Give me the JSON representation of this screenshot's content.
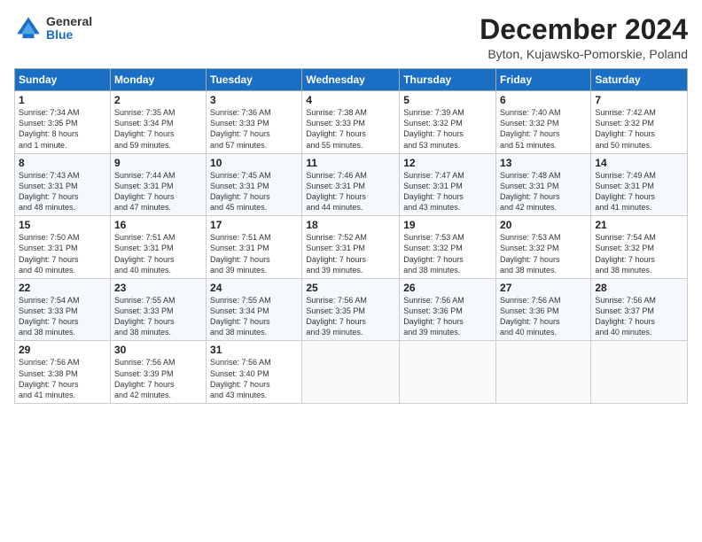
{
  "header": {
    "logo_general": "General",
    "logo_blue": "Blue",
    "month_title": "December 2024",
    "location": "Byton, Kujawsko-Pomorskie, Poland"
  },
  "weekdays": [
    "Sunday",
    "Monday",
    "Tuesday",
    "Wednesday",
    "Thursday",
    "Friday",
    "Saturday"
  ],
  "weeks": [
    [
      {
        "day": "1",
        "info": "Sunrise: 7:34 AM\nSunset: 3:35 PM\nDaylight: 8 hours\nand 1 minute."
      },
      {
        "day": "2",
        "info": "Sunrise: 7:35 AM\nSunset: 3:34 PM\nDaylight: 7 hours\nand 59 minutes."
      },
      {
        "day": "3",
        "info": "Sunrise: 7:36 AM\nSunset: 3:33 PM\nDaylight: 7 hours\nand 57 minutes."
      },
      {
        "day": "4",
        "info": "Sunrise: 7:38 AM\nSunset: 3:33 PM\nDaylight: 7 hours\nand 55 minutes."
      },
      {
        "day": "5",
        "info": "Sunrise: 7:39 AM\nSunset: 3:32 PM\nDaylight: 7 hours\nand 53 minutes."
      },
      {
        "day": "6",
        "info": "Sunrise: 7:40 AM\nSunset: 3:32 PM\nDaylight: 7 hours\nand 51 minutes."
      },
      {
        "day": "7",
        "info": "Sunrise: 7:42 AM\nSunset: 3:32 PM\nDaylight: 7 hours\nand 50 minutes."
      }
    ],
    [
      {
        "day": "8",
        "info": "Sunrise: 7:43 AM\nSunset: 3:31 PM\nDaylight: 7 hours\nand 48 minutes."
      },
      {
        "day": "9",
        "info": "Sunrise: 7:44 AM\nSunset: 3:31 PM\nDaylight: 7 hours\nand 47 minutes."
      },
      {
        "day": "10",
        "info": "Sunrise: 7:45 AM\nSunset: 3:31 PM\nDaylight: 7 hours\nand 45 minutes."
      },
      {
        "day": "11",
        "info": "Sunrise: 7:46 AM\nSunset: 3:31 PM\nDaylight: 7 hours\nand 44 minutes."
      },
      {
        "day": "12",
        "info": "Sunrise: 7:47 AM\nSunset: 3:31 PM\nDaylight: 7 hours\nand 43 minutes."
      },
      {
        "day": "13",
        "info": "Sunrise: 7:48 AM\nSunset: 3:31 PM\nDaylight: 7 hours\nand 42 minutes."
      },
      {
        "day": "14",
        "info": "Sunrise: 7:49 AM\nSunset: 3:31 PM\nDaylight: 7 hours\nand 41 minutes."
      }
    ],
    [
      {
        "day": "15",
        "info": "Sunrise: 7:50 AM\nSunset: 3:31 PM\nDaylight: 7 hours\nand 40 minutes."
      },
      {
        "day": "16",
        "info": "Sunrise: 7:51 AM\nSunset: 3:31 PM\nDaylight: 7 hours\nand 40 minutes."
      },
      {
        "day": "17",
        "info": "Sunrise: 7:51 AM\nSunset: 3:31 PM\nDaylight: 7 hours\nand 39 minutes."
      },
      {
        "day": "18",
        "info": "Sunrise: 7:52 AM\nSunset: 3:31 PM\nDaylight: 7 hours\nand 39 minutes."
      },
      {
        "day": "19",
        "info": "Sunrise: 7:53 AM\nSunset: 3:32 PM\nDaylight: 7 hours\nand 38 minutes."
      },
      {
        "day": "20",
        "info": "Sunrise: 7:53 AM\nSunset: 3:32 PM\nDaylight: 7 hours\nand 38 minutes."
      },
      {
        "day": "21",
        "info": "Sunrise: 7:54 AM\nSunset: 3:32 PM\nDaylight: 7 hours\nand 38 minutes."
      }
    ],
    [
      {
        "day": "22",
        "info": "Sunrise: 7:54 AM\nSunset: 3:33 PM\nDaylight: 7 hours\nand 38 minutes."
      },
      {
        "day": "23",
        "info": "Sunrise: 7:55 AM\nSunset: 3:33 PM\nDaylight: 7 hours\nand 38 minutes."
      },
      {
        "day": "24",
        "info": "Sunrise: 7:55 AM\nSunset: 3:34 PM\nDaylight: 7 hours\nand 38 minutes."
      },
      {
        "day": "25",
        "info": "Sunrise: 7:56 AM\nSunset: 3:35 PM\nDaylight: 7 hours\nand 39 minutes."
      },
      {
        "day": "26",
        "info": "Sunrise: 7:56 AM\nSunset: 3:36 PM\nDaylight: 7 hours\nand 39 minutes."
      },
      {
        "day": "27",
        "info": "Sunrise: 7:56 AM\nSunset: 3:36 PM\nDaylight: 7 hours\nand 40 minutes."
      },
      {
        "day": "28",
        "info": "Sunrise: 7:56 AM\nSunset: 3:37 PM\nDaylight: 7 hours\nand 40 minutes."
      }
    ],
    [
      {
        "day": "29",
        "info": "Sunrise: 7:56 AM\nSunset: 3:38 PM\nDaylight: 7 hours\nand 41 minutes."
      },
      {
        "day": "30",
        "info": "Sunrise: 7:56 AM\nSunset: 3:39 PM\nDaylight: 7 hours\nand 42 minutes."
      },
      {
        "day": "31",
        "info": "Sunrise: 7:56 AM\nSunset: 3:40 PM\nDaylight: 7 hours\nand 43 minutes."
      },
      {
        "day": "",
        "info": ""
      },
      {
        "day": "",
        "info": ""
      },
      {
        "day": "",
        "info": ""
      },
      {
        "day": "",
        "info": ""
      }
    ]
  ]
}
